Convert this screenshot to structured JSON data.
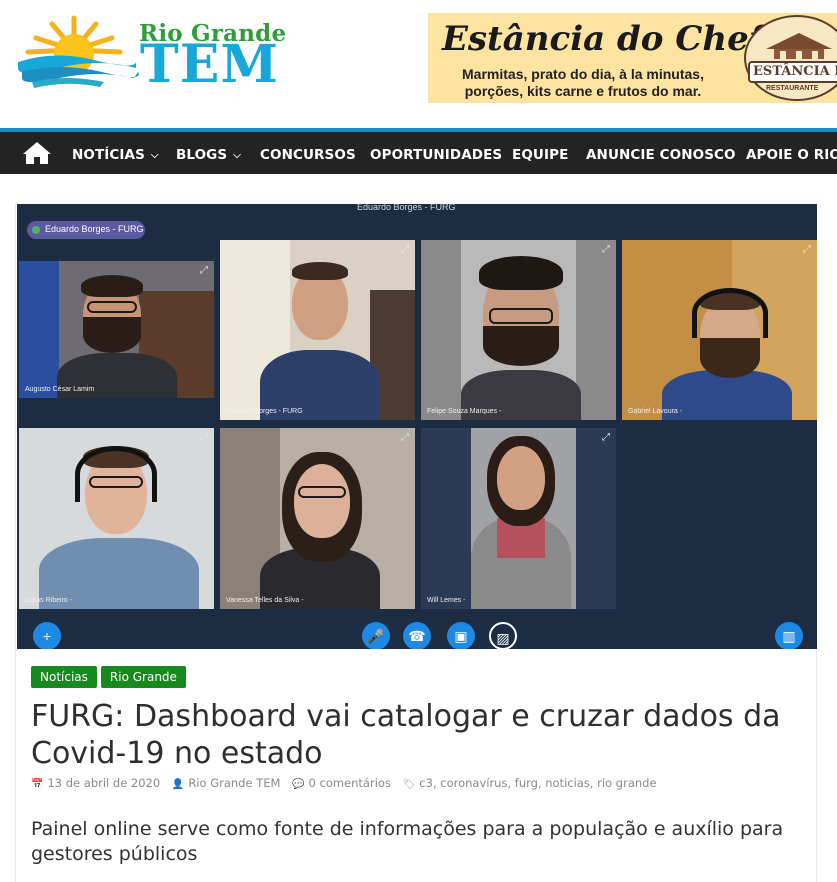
{
  "site": {
    "logo_line1": "Rio Grande",
    "logo_line2": "TEM",
    "colors": {
      "nav_bg": "#232323",
      "nav_accent": "#1f87c4",
      "tag_bg": "#178a1e",
      "logo_green": "#2f9d3a",
      "logo_blue": "#17a7d8"
    }
  },
  "ad": {
    "title": "Estância do Cheff",
    "subtitle_line1": "Marmitas, prato do dia, à la minutas,",
    "subtitle_line2": "porções, kits carne e frutos do mar.",
    "badge_text": "ESTÂNCIA DO CHEFF",
    "badge_sub": "RESTAURANTE"
  },
  "nav": {
    "home_icon": "home-icon",
    "items": [
      {
        "label": "NOTÍCIAS",
        "has_dropdown": true
      },
      {
        "label": "BLOGS",
        "has_dropdown": true
      },
      {
        "label": "CONCURSOS",
        "has_dropdown": false
      },
      {
        "label": "OPORTUNIDADES",
        "has_dropdown": false
      },
      {
        "label": "EQUIPE",
        "has_dropdown": false
      },
      {
        "label": "ANUNCIE CONOSCO",
        "has_dropdown": false
      },
      {
        "label": "APOIE O RIO G",
        "has_dropdown": false
      }
    ]
  },
  "hero": {
    "meeting_title": "Eduardo Borges - FURG",
    "presenter_pill": "Eduardo Borges - FURG",
    "participants": [
      "Augusto César Lamim",
      "Eduardo Borges - FURG",
      "Felipe Souza Marques -",
      "Gabriel Lavoura -",
      "Lucas Ribeiro -",
      "Vanessa Telles da Silva -",
      "Will Lemes -"
    ]
  },
  "article": {
    "categories": [
      "Notícias",
      "Rio Grande"
    ],
    "title": "FURG: Dashboard vai catalogar e cruzar dados da Covid-19 no estado",
    "date": "13 de abril de 2020",
    "author": "Rio Grande TEM",
    "comments": "0 comentários",
    "tags": [
      "c3",
      "coronavírus",
      "furg",
      "noticias",
      "rio grande"
    ],
    "lead": "Painel online serve como fonte de informações para a população e auxílio para gestores públicos"
  }
}
